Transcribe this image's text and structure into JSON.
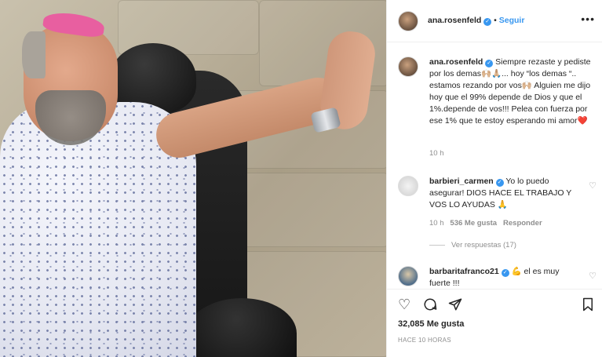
{
  "header": {
    "username": "ana.rosenfeld",
    "separator": "•",
    "follow_label": "Seguir",
    "more_icon": "more-horizontal-icon"
  },
  "caption": {
    "username": "ana.rosenfeld",
    "text": "Siempre rezaste y pediste por los demas🙌🏼🙏🏼... hoy “los demas “.. estamos rezando por vos🙌🏼 Alguien me dijo hoy que el 99% depende de Dios y que el 1%.depende de vos!!! Pelea con fuerza por ese 1% que te estoy esperando mi amor❤️",
    "time": "10 h"
  },
  "comments": [
    {
      "username": "barbieri_carmen",
      "text": "Yo lo puedo asegurar! DIOS HACE EL TRABAJO Y VOS LO AYUDAS 🙏",
      "time": "10 h",
      "likes": "536 Me gusta",
      "reply_label": "Responder",
      "view_replies": "Ver respuestas (17)"
    },
    {
      "username": "barbaritafranco21",
      "text": "💪 el es muy fuerte !!!"
    }
  ],
  "actions": {
    "likes": "32,085 Me gusta",
    "posted_ago": "HACE 10 HORAS"
  },
  "colors": {
    "accent": "#3897f0",
    "text": "#262626",
    "muted": "#8e8e8e",
    "border": "#efefef"
  }
}
